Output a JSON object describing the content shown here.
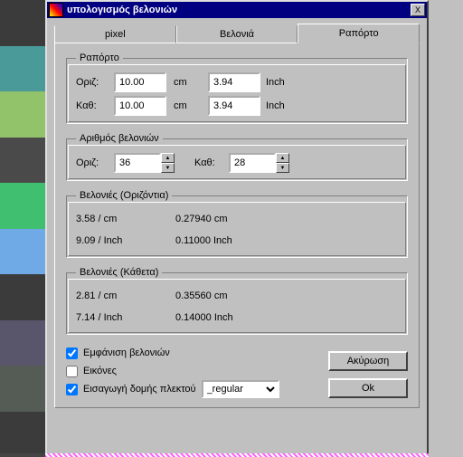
{
  "window": {
    "title": "υπολογισμός βελονιών",
    "close": "X"
  },
  "tabs": {
    "pixel": "pixel",
    "stitch": "Βελονιά",
    "repeat": "Ραπόρτο"
  },
  "groups": {
    "repeat": "Ραπόρτο",
    "count": "Αριθμός βελονιών",
    "horiz": "Βελονιές (Οριζόντια)",
    "vert": "Βελονιές (Κάθετα)"
  },
  "labels": {
    "horiz": "Οριζ:",
    "vert": "Καθ:",
    "cm": "cm",
    "inch": "Inch"
  },
  "repeat": {
    "h_cm": "10.00",
    "h_in": "3.94",
    "v_cm": "10.00",
    "v_in": "3.94"
  },
  "count": {
    "h": "36",
    "v": "28"
  },
  "horiz": {
    "per_cm": "3.58 / cm",
    "cm": "0.27940 cm",
    "per_in": "9.09 / Inch",
    "in": "0.11000 Inch"
  },
  "vert": {
    "per_cm": "2.81 / cm",
    "cm": "0.35560 cm",
    "per_in": "7.14 / Inch",
    "in": "0.14000 Inch"
  },
  "checks": {
    "show": "Εμφάνιση βελονιών",
    "images": "Εικόνες",
    "import": "Εισαγωγή δομής πλεκτού"
  },
  "combo": {
    "value": "_regular"
  },
  "buttons": {
    "cancel": "Ακύρωση",
    "ok": "Ok"
  },
  "stripes": [
    "#3b3b3b",
    "#4a9a9a",
    "#92c269",
    "#4a4a4a",
    "#3fbf6f",
    "#6fa9e6",
    "#3b3b3b",
    "#59556b",
    "#555b55",
    "#3b3b3b"
  ]
}
